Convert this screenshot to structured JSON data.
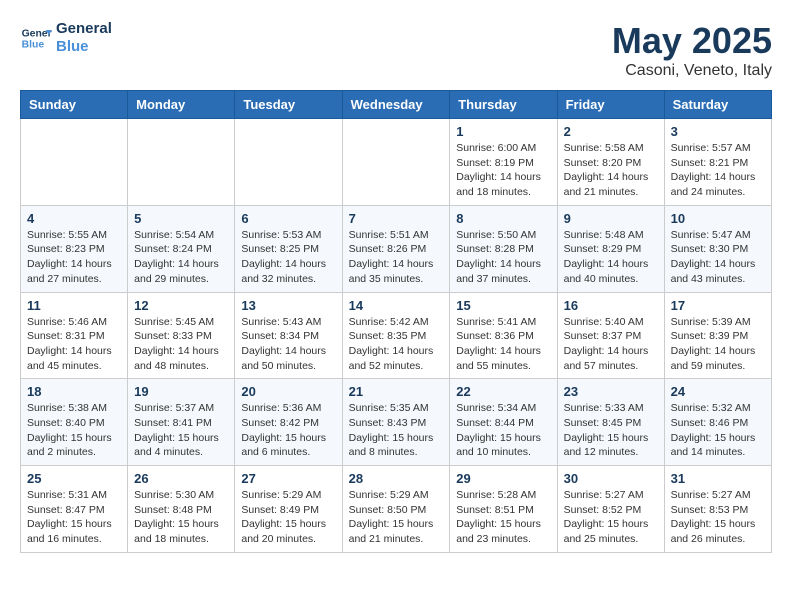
{
  "header": {
    "logo": {
      "line1": "General",
      "line2": "Blue"
    },
    "title": "May 2025",
    "subtitle": "Casoni, Veneto, Italy"
  },
  "days_of_week": [
    "Sunday",
    "Monday",
    "Tuesday",
    "Wednesday",
    "Thursday",
    "Friday",
    "Saturday"
  ],
  "weeks": [
    [
      {
        "day": "",
        "info": ""
      },
      {
        "day": "",
        "info": ""
      },
      {
        "day": "",
        "info": ""
      },
      {
        "day": "",
        "info": ""
      },
      {
        "day": "1",
        "info": "Sunrise: 6:00 AM\nSunset: 8:19 PM\nDaylight: 14 hours\nand 18 minutes."
      },
      {
        "day": "2",
        "info": "Sunrise: 5:58 AM\nSunset: 8:20 PM\nDaylight: 14 hours\nand 21 minutes."
      },
      {
        "day": "3",
        "info": "Sunrise: 5:57 AM\nSunset: 8:21 PM\nDaylight: 14 hours\nand 24 minutes."
      }
    ],
    [
      {
        "day": "4",
        "info": "Sunrise: 5:55 AM\nSunset: 8:23 PM\nDaylight: 14 hours\nand 27 minutes."
      },
      {
        "day": "5",
        "info": "Sunrise: 5:54 AM\nSunset: 8:24 PM\nDaylight: 14 hours\nand 29 minutes."
      },
      {
        "day": "6",
        "info": "Sunrise: 5:53 AM\nSunset: 8:25 PM\nDaylight: 14 hours\nand 32 minutes."
      },
      {
        "day": "7",
        "info": "Sunrise: 5:51 AM\nSunset: 8:26 PM\nDaylight: 14 hours\nand 35 minutes."
      },
      {
        "day": "8",
        "info": "Sunrise: 5:50 AM\nSunset: 8:28 PM\nDaylight: 14 hours\nand 37 minutes."
      },
      {
        "day": "9",
        "info": "Sunrise: 5:48 AM\nSunset: 8:29 PM\nDaylight: 14 hours\nand 40 minutes."
      },
      {
        "day": "10",
        "info": "Sunrise: 5:47 AM\nSunset: 8:30 PM\nDaylight: 14 hours\nand 43 minutes."
      }
    ],
    [
      {
        "day": "11",
        "info": "Sunrise: 5:46 AM\nSunset: 8:31 PM\nDaylight: 14 hours\nand 45 minutes."
      },
      {
        "day": "12",
        "info": "Sunrise: 5:45 AM\nSunset: 8:33 PM\nDaylight: 14 hours\nand 48 minutes."
      },
      {
        "day": "13",
        "info": "Sunrise: 5:43 AM\nSunset: 8:34 PM\nDaylight: 14 hours\nand 50 minutes."
      },
      {
        "day": "14",
        "info": "Sunrise: 5:42 AM\nSunset: 8:35 PM\nDaylight: 14 hours\nand 52 minutes."
      },
      {
        "day": "15",
        "info": "Sunrise: 5:41 AM\nSunset: 8:36 PM\nDaylight: 14 hours\nand 55 minutes."
      },
      {
        "day": "16",
        "info": "Sunrise: 5:40 AM\nSunset: 8:37 PM\nDaylight: 14 hours\nand 57 minutes."
      },
      {
        "day": "17",
        "info": "Sunrise: 5:39 AM\nSunset: 8:39 PM\nDaylight: 14 hours\nand 59 minutes."
      }
    ],
    [
      {
        "day": "18",
        "info": "Sunrise: 5:38 AM\nSunset: 8:40 PM\nDaylight: 15 hours\nand 2 minutes."
      },
      {
        "day": "19",
        "info": "Sunrise: 5:37 AM\nSunset: 8:41 PM\nDaylight: 15 hours\nand 4 minutes."
      },
      {
        "day": "20",
        "info": "Sunrise: 5:36 AM\nSunset: 8:42 PM\nDaylight: 15 hours\nand 6 minutes."
      },
      {
        "day": "21",
        "info": "Sunrise: 5:35 AM\nSunset: 8:43 PM\nDaylight: 15 hours\nand 8 minutes."
      },
      {
        "day": "22",
        "info": "Sunrise: 5:34 AM\nSunset: 8:44 PM\nDaylight: 15 hours\nand 10 minutes."
      },
      {
        "day": "23",
        "info": "Sunrise: 5:33 AM\nSunset: 8:45 PM\nDaylight: 15 hours\nand 12 minutes."
      },
      {
        "day": "24",
        "info": "Sunrise: 5:32 AM\nSunset: 8:46 PM\nDaylight: 15 hours\nand 14 minutes."
      }
    ],
    [
      {
        "day": "25",
        "info": "Sunrise: 5:31 AM\nSunset: 8:47 PM\nDaylight: 15 hours\nand 16 minutes."
      },
      {
        "day": "26",
        "info": "Sunrise: 5:30 AM\nSunset: 8:48 PM\nDaylight: 15 hours\nand 18 minutes."
      },
      {
        "day": "27",
        "info": "Sunrise: 5:29 AM\nSunset: 8:49 PM\nDaylight: 15 hours\nand 20 minutes."
      },
      {
        "day": "28",
        "info": "Sunrise: 5:29 AM\nSunset: 8:50 PM\nDaylight: 15 hours\nand 21 minutes."
      },
      {
        "day": "29",
        "info": "Sunrise: 5:28 AM\nSunset: 8:51 PM\nDaylight: 15 hours\nand 23 minutes."
      },
      {
        "day": "30",
        "info": "Sunrise: 5:27 AM\nSunset: 8:52 PM\nDaylight: 15 hours\nand 25 minutes."
      },
      {
        "day": "31",
        "info": "Sunrise: 5:27 AM\nSunset: 8:53 PM\nDaylight: 15 hours\nand 26 minutes."
      }
    ]
  ]
}
